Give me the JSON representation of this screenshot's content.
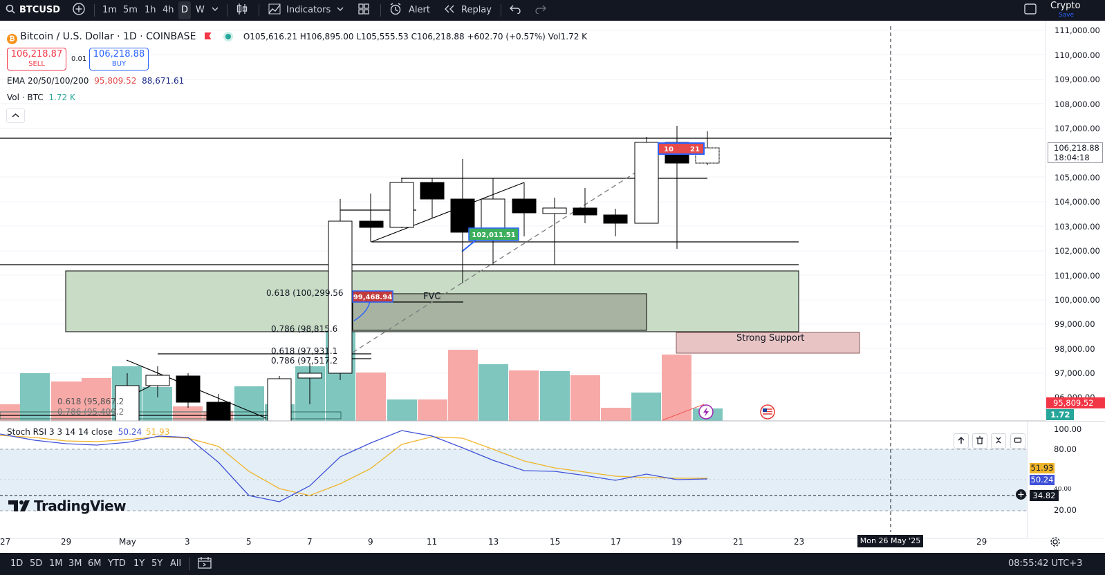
{
  "topbar": {
    "symbol": "BTCUSD",
    "intervals": [
      "1m",
      "5m",
      "1h",
      "4h",
      "D",
      "W"
    ],
    "active_interval": "D",
    "indicators_label": "Indicators",
    "alert_label": "Alert",
    "replay_label": "Replay",
    "crypto_label": "Crypto",
    "save_label": "Save"
  },
  "legend": {
    "title": "Bitcoin / U.S. Dollar · 1D · COINBASE",
    "ohlc": "O105,616.21 H106,895.00 L105,555.53 C106,218.88 +602.70 (+0.57%) Vol1.72 K",
    "sell_price": "106,218.87",
    "sell_label": "SELL",
    "spread": "0.01",
    "buy_price": "106,218.88",
    "buy_label": "BUY",
    "ema_label": "EMA 20/50/100/200",
    "ema_val1": "95,809.52",
    "ema_val2": "88,671.61",
    "vol_label": "Vol · BTC",
    "vol_val": "1.72 K"
  },
  "price_axis": [
    "111,000.00",
    "110,000.00",
    "109,000.00",
    "108,000.00",
    "107,000.00",
    "105,000.00",
    "104,000.00",
    "103,000.00",
    "102,000.00",
    "101,000.00",
    "100,000.00",
    "99,000.00",
    "98,000.00",
    "97,000.00",
    "96,000.00"
  ],
  "last_price": "106,218.88",
  "countdown": "18:04:18",
  "ema_tag": "95,809.52",
  "vol_tag": "1.72 K",
  "annotations": {
    "fib_618_top": "0.618 (100,299.56",
    "fib_786_top": "0.786 (98,815.6",
    "fib_618_mid": "0.618 (97,931.1",
    "fib_786_mid": "0.786 (97,517.2",
    "fib_618_low": "0.618 (95,867.2",
    "fib_786_low": "0.786 (95,409.2",
    "fvc": "FVC",
    "strong_support": "Strong Support",
    "red_label": "99,468.94",
    "green_label": "102,011.51",
    "blue_label": "10",
    "blue_label2": "21"
  },
  "stoch": {
    "label": "Stoch RSI 3 3 14 14 close",
    "k": "50.24",
    "d": "51.93",
    "axis": [
      "100.00",
      "80.00",
      "20.00"
    ],
    "crosshair": "34.82",
    "k_tag": "50.24",
    "d_tag": "51.93",
    "partial": "40.00"
  },
  "time_axis": [
    "27",
    "29",
    "May",
    "3",
    "5",
    "7",
    "9",
    "11",
    "13",
    "15",
    "17",
    "19",
    "21",
    "23",
    "29"
  ],
  "crosshair_date": "Mon 26 May '25",
  "watermark": "TradingView",
  "ranges": [
    "1D",
    "5D",
    "1M",
    "3M",
    "6M",
    "YTD",
    "1Y",
    "5Y",
    "All"
  ],
  "clock": "08:55:42 UTC+3",
  "colors": {
    "up": "#ffffff",
    "down": "#000000",
    "vol_up": "#26a69a",
    "vol_down": "#ef5350",
    "k": "#3f51d8",
    "d": "#f0b429",
    "bg": "#131722"
  }
}
